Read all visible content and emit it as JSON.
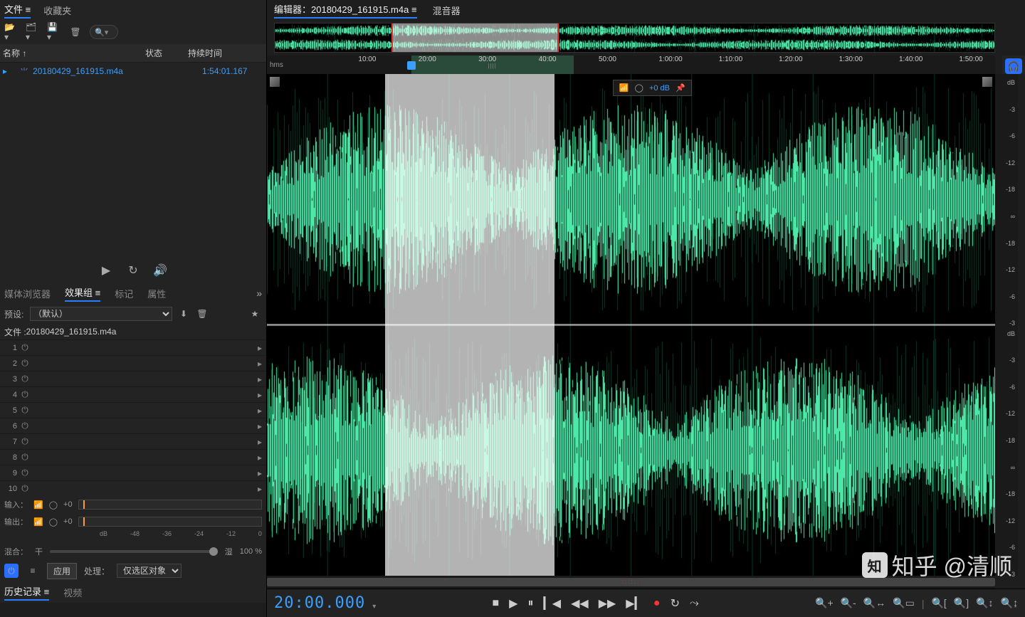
{
  "menu": {
    "file": "文件  ≡",
    "fav": "收藏夹"
  },
  "files": {
    "header": {
      "name": "名称 ↑",
      "status": "状态",
      "duration": "持续时间"
    },
    "items": [
      {
        "name": "20180429_161915.m4a",
        "duration": "1:54:01.167"
      }
    ]
  },
  "tabs2": {
    "media": "媒体浏览器",
    "fx": "效果组",
    "marker": "标记",
    "prop": "属性"
  },
  "preset": {
    "label": "预设:",
    "value": "（默认）"
  },
  "file_label_prefix": "文件 :",
  "file_label_name": "20180429_161915.m4a",
  "fx_slots": [
    "1",
    "2",
    "3",
    "4",
    "5",
    "6",
    "7",
    "8",
    "9",
    "10"
  ],
  "io": {
    "in": "输入：",
    "out": "输出：",
    "val": "+0"
  },
  "db_ticks": [
    "dB",
    "-48",
    "-36",
    "-24",
    "-12",
    "0"
  ],
  "mix": {
    "label": "混合：",
    "dry": "干",
    "wet": "湿",
    "pct": "100 %"
  },
  "apply": {
    "apply": "应用",
    "proc": "处理：",
    "sel_only": "仅选区对象"
  },
  "tabs3": {
    "history": "历史记录",
    "video": "视频"
  },
  "editor": {
    "tab1": "编辑器：20180429_161915.m4a  ≡",
    "tab2": "混音器",
    "hms": "hms",
    "ticks": [
      "10:00",
      "20:00",
      "30:00",
      "40:00",
      "50:00",
      "1:00:00",
      "1:10:00",
      "1:20:00",
      "1:30:00",
      "1:40:00",
      "1:50:00"
    ],
    "db_labels": [
      "dB",
      "-3",
      "-6",
      "-12",
      "-18",
      "∞",
      "-18",
      "-12",
      "-6",
      "-3"
    ],
    "hud_db": "+0 dB",
    "selection_start_pct": 16.2,
    "selection_end_pct": 39.5,
    "playhead_pct": 16.2
  },
  "timecode": "20:00.000",
  "watermark": "知乎 @清顺",
  "colors": {
    "wave": "#4de8a8",
    "accent": "#3a9fff"
  }
}
